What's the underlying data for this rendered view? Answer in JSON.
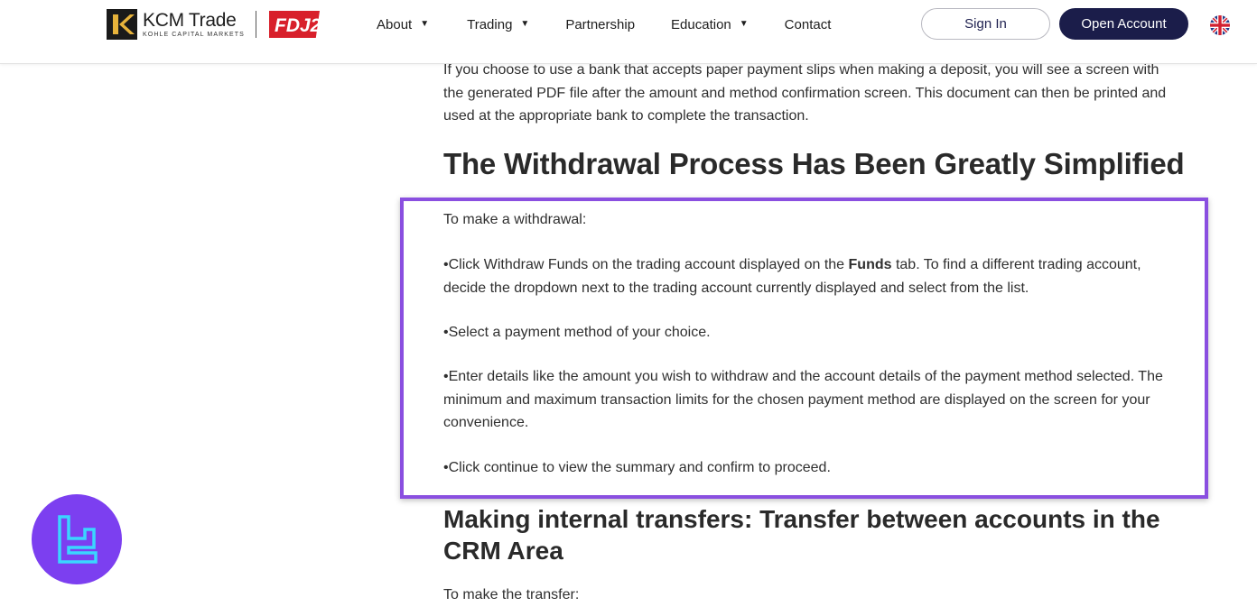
{
  "header": {
    "brand_name": "KCM Trade",
    "brand_sub": "KOHLE CAPITAL MARKETS",
    "partner_logo": "FDJ2",
    "nav": [
      {
        "label": "About",
        "has_caret": true
      },
      {
        "label": "Trading",
        "has_caret": true
      },
      {
        "label": "Partnership",
        "has_caret": false
      },
      {
        "label": "Education",
        "has_caret": true
      },
      {
        "label": "Contact",
        "has_caret": false
      }
    ],
    "signin_label": "Sign In",
    "open_account_label": "Open Account",
    "language_icon": "uk-flag-icon"
  },
  "content": {
    "intro": "If you choose to use a bank that accepts paper payment slips when making a deposit, you will see a screen with the generated PDF file after the amount and method confirmation screen. This document can then be printed and used at the appropriate bank to complete the transaction.",
    "withdrawal_heading": "The Withdrawal Process Has Been Greatly Simplified",
    "withdrawal_intro": "To make a withdrawal:",
    "bullet1_before": "•Click Withdraw Funds on the trading account displayed on the ",
    "bullet1_bold": "Funds",
    "bullet1_after": " tab. To find a different trading account, decide the dropdown next to the trading account currently displayed and select from the list.",
    "bullet2": "•Select a payment method of your choice.",
    "bullet3": "•Enter details like the amount you wish to withdraw and the account details of the payment method selected. The minimum and maximum transaction limits for the chosen payment method are displayed on the screen for your convenience.",
    "bullet4": "•Click continue to view the summary and confirm to proceed.",
    "transfer_heading": "Making internal transfers: Transfer between accounts in the CRM Area",
    "transfer_intro": "To make the transfer:"
  },
  "colors": {
    "highlight_border": "#8a4fe0",
    "open_account_bg": "#1b1d4a",
    "badge_bg": "#7c3ff0",
    "badge_icon": "#3ad6ff"
  },
  "badge": {
    "icon": "tradingfinder-logo-icon"
  }
}
